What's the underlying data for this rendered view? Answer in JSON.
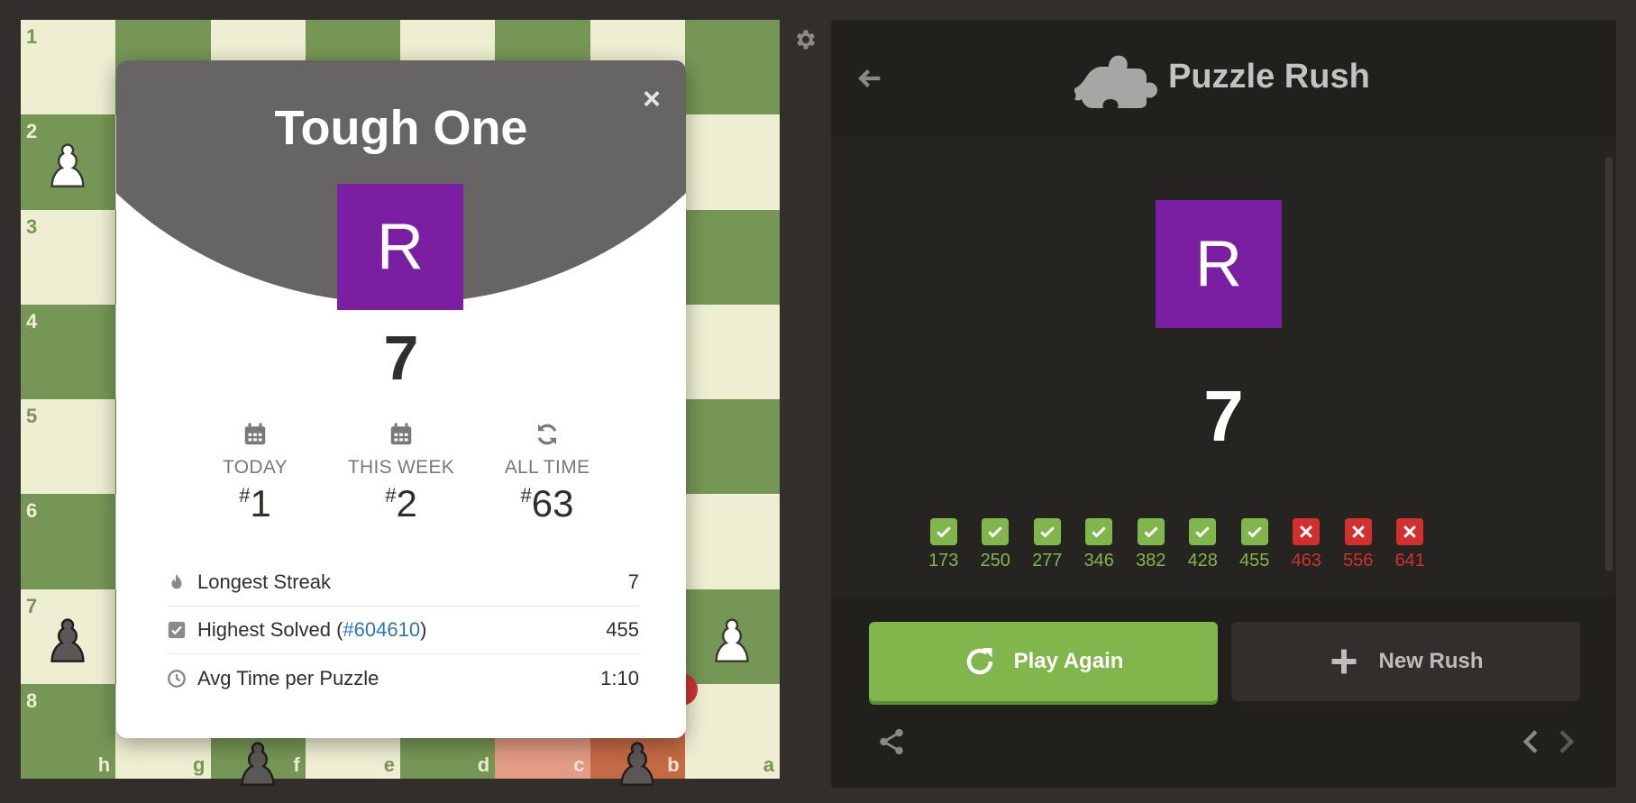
{
  "board": {
    "ranks": [
      "1",
      "2",
      "3",
      "4",
      "5",
      "6",
      "7",
      "8"
    ],
    "files": [
      "h",
      "g",
      "f",
      "e",
      "d",
      "c",
      "b",
      "a"
    ]
  },
  "modal": {
    "title": "Tough One",
    "close_symbol": "×",
    "avatar_letter": "R",
    "score": "7",
    "rankings": [
      {
        "label": "TODAY",
        "hash": "#",
        "value": "1",
        "icon": "calendar-icon"
      },
      {
        "label": "THIS WEEK",
        "hash": "#",
        "value": "2",
        "icon": "calendar-icon"
      },
      {
        "label": "ALL TIME",
        "hash": "#",
        "value": "63",
        "icon": "refresh-icon"
      }
    ],
    "stats": {
      "longest_streak_label": "Longest Streak",
      "longest_streak_value": "7",
      "highest_solved_label": "Highest Solved (",
      "highest_solved_link": "#604610",
      "highest_solved_close": ")",
      "highest_solved_value": "455",
      "avg_time_label": "Avg Time per Puzzle",
      "avg_time_value": "1:10"
    }
  },
  "panel": {
    "title": "Puzzle Rush",
    "avatar_letter": "R",
    "score": "7",
    "puzzles": [
      {
        "rating": "173",
        "solved": true
      },
      {
        "rating": "250",
        "solved": true
      },
      {
        "rating": "277",
        "solved": true
      },
      {
        "rating": "346",
        "solved": true
      },
      {
        "rating": "382",
        "solved": true
      },
      {
        "rating": "428",
        "solved": true
      },
      {
        "rating": "455",
        "solved": true
      },
      {
        "rating": "463",
        "solved": false
      },
      {
        "rating": "556",
        "solved": false
      },
      {
        "rating": "641",
        "solved": false
      }
    ],
    "play_again_label": "Play Again",
    "new_rush_label": "New Rush"
  },
  "colors": {
    "background": "#312e2b",
    "board_light": "#eeeed2",
    "board_dark": "#769656",
    "accent_green": "#81b64c",
    "error_red": "#d32f2f",
    "avatar_purple": "#7b1fa2",
    "modal_header": "#666564"
  }
}
